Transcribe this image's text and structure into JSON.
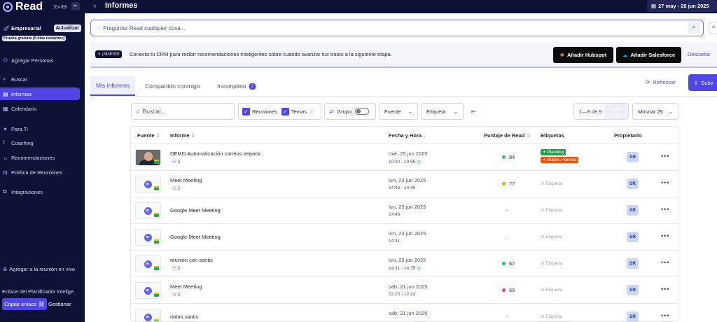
{
  "app": {
    "name": "Read",
    "language": "ES"
  },
  "sidebar": {
    "plan_name": "Empresarial",
    "upgrade_label": "Actualizar",
    "trial_text": "Prueba gratuita (9 días restantes)",
    "add_people": "Agregar Personas",
    "items": [
      {
        "label": "Buscar",
        "icon": "search-icon"
      },
      {
        "label": "Informes",
        "icon": "document-icon",
        "active": true
      },
      {
        "label": "Calendario",
        "icon": "calendar-icon"
      },
      {
        "label": "Para Ti",
        "icon": "sparkle-icon"
      },
      {
        "label": "Coaching",
        "icon": "coaching-icon"
      },
      {
        "label": "Recomendaciones",
        "icon": "lightbulb-icon"
      },
      {
        "label": "Política de Reuniones",
        "icon": "policy-icon"
      },
      {
        "label": "Integraciones",
        "icon": "puzzle-icon"
      }
    ],
    "live_meeting": "Agregar a la reunión en vivo",
    "planner_text": "Enlace del Planificador intelige",
    "copy_link": "Copiar enlace",
    "manage": "Gestionar"
  },
  "header": {
    "title": "Informes",
    "date_range": "27 may - 26 jun 2025"
  },
  "ask": {
    "placeholder": "Preguntar Read cualquier cosa..."
  },
  "banner": {
    "badge": "¡NUEVO!",
    "text": "Conecta tu CRM para recibir recomendaciones inteligentes sobre cuándo avanzar tus tratos a la siguiente etapa.",
    "hubspot": "Añadir Hubspot",
    "salesforce": "Añadir Salesforce",
    "discard": "Descartar"
  },
  "tabs": {
    "mine": "Mis informes",
    "shared": "Compartido conmigo",
    "incomplete": "Incompleto",
    "incomplete_count": "2"
  },
  "actions": {
    "refresh": "Refrescar",
    "upload": "Subir"
  },
  "toolbar": {
    "search_placeholder": "Buscar...",
    "meetings": "Reuniones",
    "topics": "Temas",
    "group": "Grupo",
    "source": "Fuente",
    "tag": "Etiqueta",
    "pagination": "1—9 de 9",
    "show": "Mostrar 25"
  },
  "table": {
    "headers": {
      "source": "Fuente",
      "report": "Informe",
      "date": "Fecha y Hora",
      "score": "Puntaje de Read",
      "tags": "Etiquetas",
      "owner": "Propietario"
    },
    "tag_placeholder": "Etiqueta",
    "rows": [
      {
        "title": "DEMO Automatización correos irepack",
        "people": "3",
        "date": "mié, 25 jun 2025",
        "time": "10:30 - 10:55",
        "score": "84",
        "score_color": "#22c55e",
        "tags": [
          "Planning",
          "Status / Review"
        ],
        "owner": "SR"
      },
      {
        "title": "Meet Meeting",
        "people": "2",
        "date": "lun, 23 jun 2025",
        "time": "14:46 - 14:46",
        "score": "77",
        "score_color": "#f59e0b",
        "owner": "SR"
      },
      {
        "title": "Google Meet Meeting",
        "date": "lun, 23 jun 2025",
        "time": "14:46",
        "score": "-",
        "owner": "SR"
      },
      {
        "title": "Google Meet Meeting",
        "date": "lun, 23 jun 2025",
        "time": "14:31",
        "score": "-",
        "owner": "SR"
      },
      {
        "title": "reunion con santis",
        "people": "2",
        "date": "lun, 23 jun 2025",
        "time": "14:31 - 14:35",
        "score": "82",
        "score_color": "#22c55e",
        "owner": "SR"
      },
      {
        "title": "Meet Meeting",
        "people": "2",
        "date": "sáb, 21 jun 2025",
        "time": "12:23 - 12:23",
        "score": "69",
        "score_color": "#f43f5e",
        "owner": "SR"
      },
      {
        "title": "notas santis",
        "date": "sáb, 21 jun 2025",
        "score": "-",
        "owner": "SR"
      }
    ]
  },
  "colors": {
    "sidebar_bg": "#0f1237",
    "accent": "#4f46e5",
    "tag_planning": "#16a34a",
    "tag_status": "#ea580c"
  }
}
